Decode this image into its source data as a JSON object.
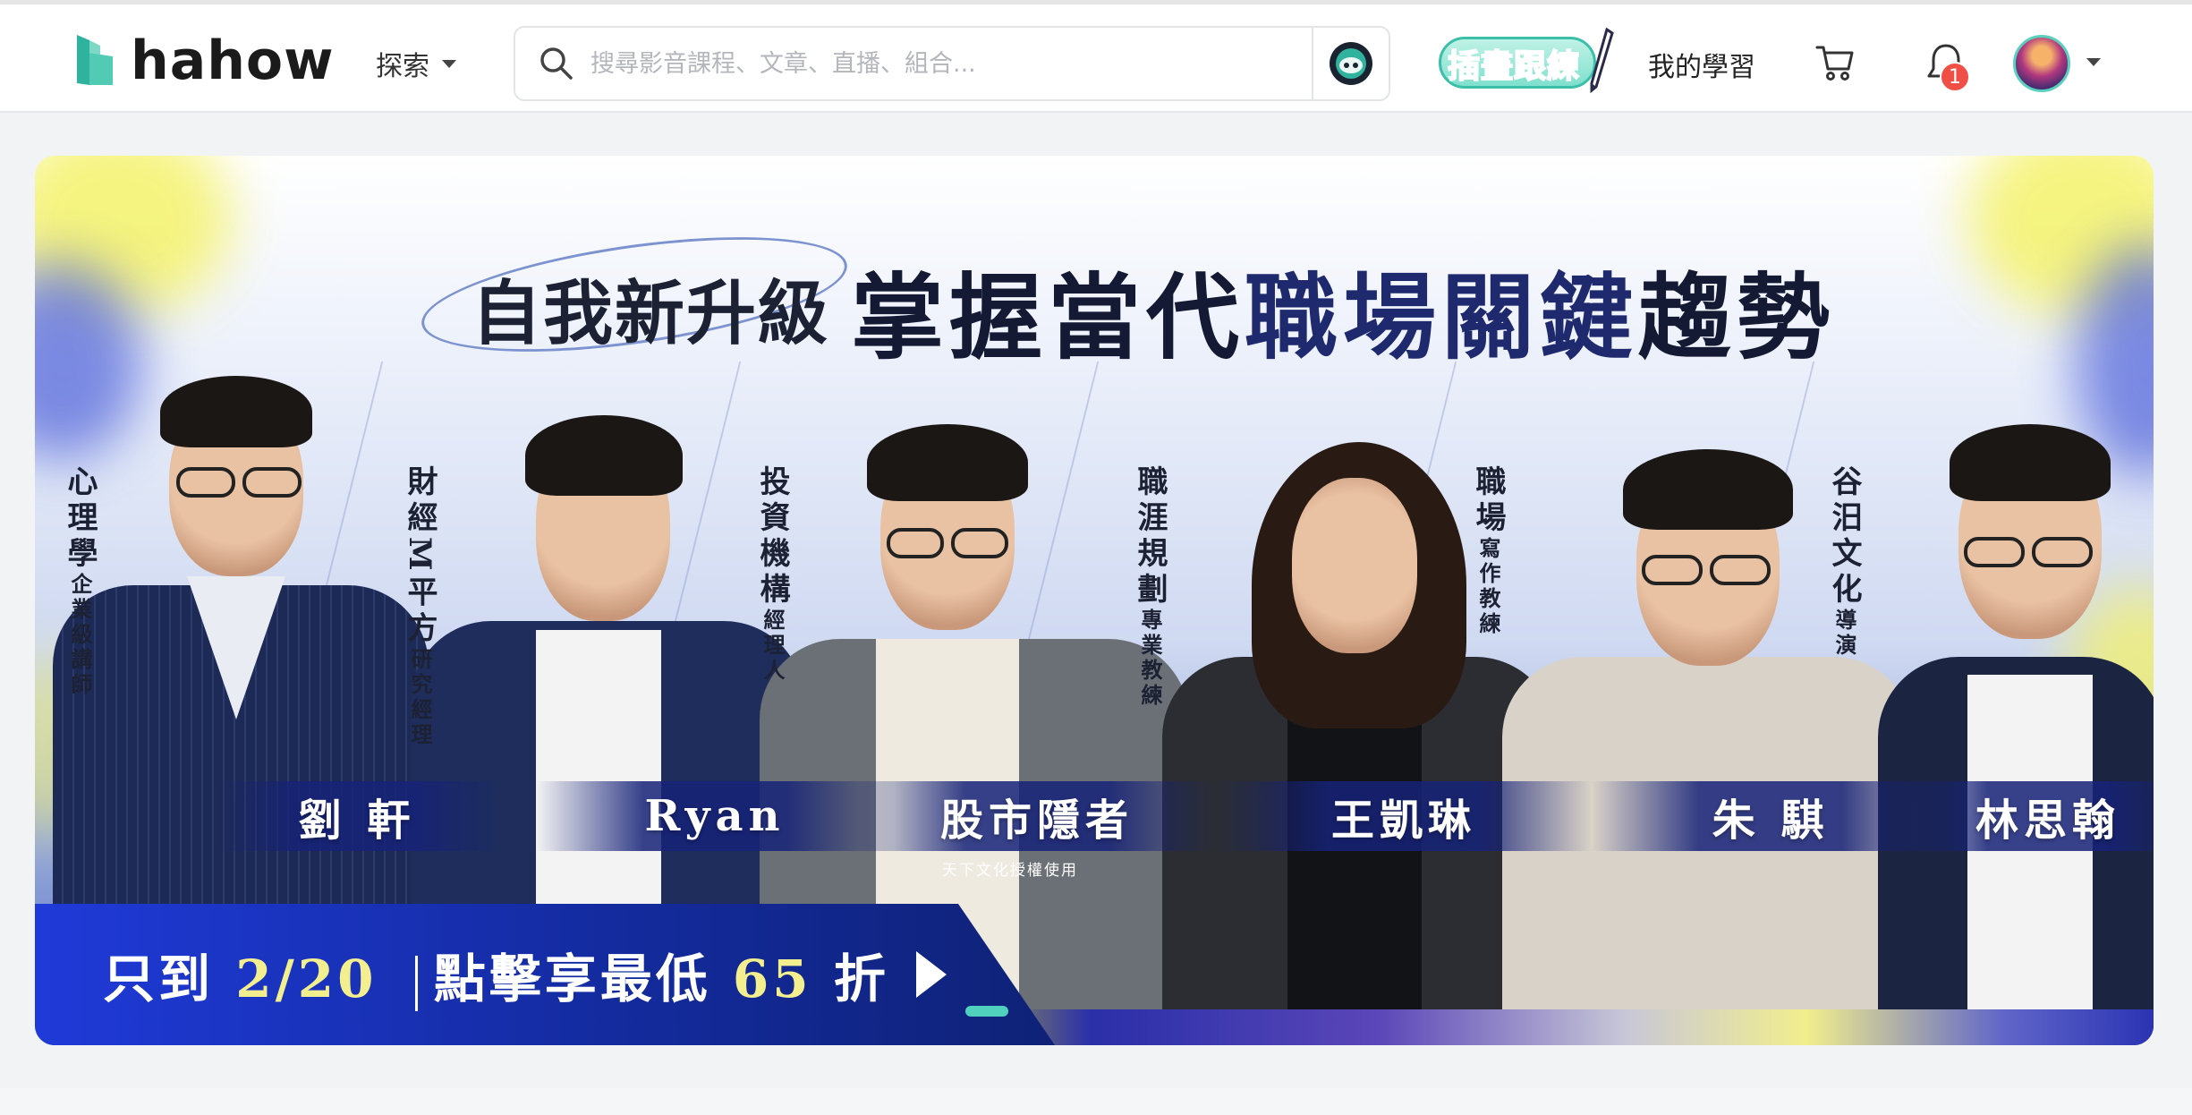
{
  "header": {
    "logo_text": "hahow",
    "explore_label": "探索",
    "search_placeholder": "搜尋影音課程、文章、直播、組合...",
    "promo_badge_label": "插畫跟練",
    "my_learning_label": "我的學習",
    "notification_count": "1",
    "icons": [
      "hahow-logo-icon",
      "chevron-down-icon",
      "search-icon",
      "ai-assistant-icon",
      "pen-icon",
      "cart-icon",
      "bell-icon",
      "avatar"
    ]
  },
  "banner": {
    "headline_left": "自我新升級",
    "headline_right_dark": "掌握當代",
    "headline_right_blue": "職場關鍵",
    "headline_right_end": "趨勢",
    "instructors": [
      {
        "role": "心理學",
        "role_sub": "企業級講師",
        "name": "劉 軒"
      },
      {
        "role": "財經M平方",
        "role_sub": "研究經理",
        "name": "Ryan"
      },
      {
        "role": "投資機構",
        "role_sub": "經理人",
        "name": "股市隱者"
      },
      {
        "role": "職涯規劃",
        "role_sub": "專業教練",
        "name": "王凱琳"
      },
      {
        "role": "職場",
        "role_sub": "寫作教練",
        "name": "朱 騏"
      },
      {
        "role": "谷汨文化",
        "role_sub": "導演",
        "name": "林思翰"
      }
    ],
    "license_note": "天下文化授權使用",
    "cta_prefix": "只到",
    "cta_date": "2/20",
    "cta_middle": "點擊享最低",
    "cta_discount": "65",
    "cta_suffix": "折",
    "colors": {
      "accent_teal": "#4fd1bd",
      "banner_navy": "#1f2a6e",
      "cta_highlight": "#f4ef8e"
    }
  }
}
